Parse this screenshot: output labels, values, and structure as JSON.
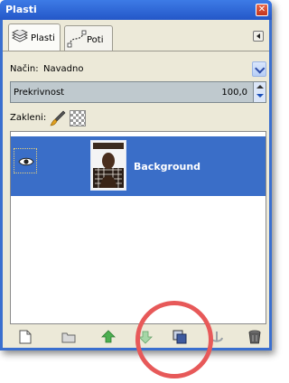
{
  "window": {
    "title": "Plasti"
  },
  "tabs": [
    {
      "label": "Plasti",
      "icon": "layers-icon",
      "active": true
    },
    {
      "label": "Poti",
      "icon": "paths-icon",
      "active": false
    }
  ],
  "mode": {
    "label": "Način:",
    "value": "Navadno"
  },
  "opacity": {
    "label": "Prekrivnost",
    "value": "100,0"
  },
  "lock": {
    "label": "Zakleni:"
  },
  "layers": [
    {
      "name": "Background",
      "visible": true,
      "selected": true
    }
  ],
  "colors": {
    "selection": "#3a6ec8",
    "highlight": "#e75959",
    "title": "#2457c8"
  },
  "bottom_buttons": [
    "new-layer-icon",
    "new-layer-group-icon",
    "raise-layer-icon",
    "lower-layer-icon",
    "duplicate-layer-icon",
    "anchor-layer-icon",
    "delete-layer-icon"
  ]
}
